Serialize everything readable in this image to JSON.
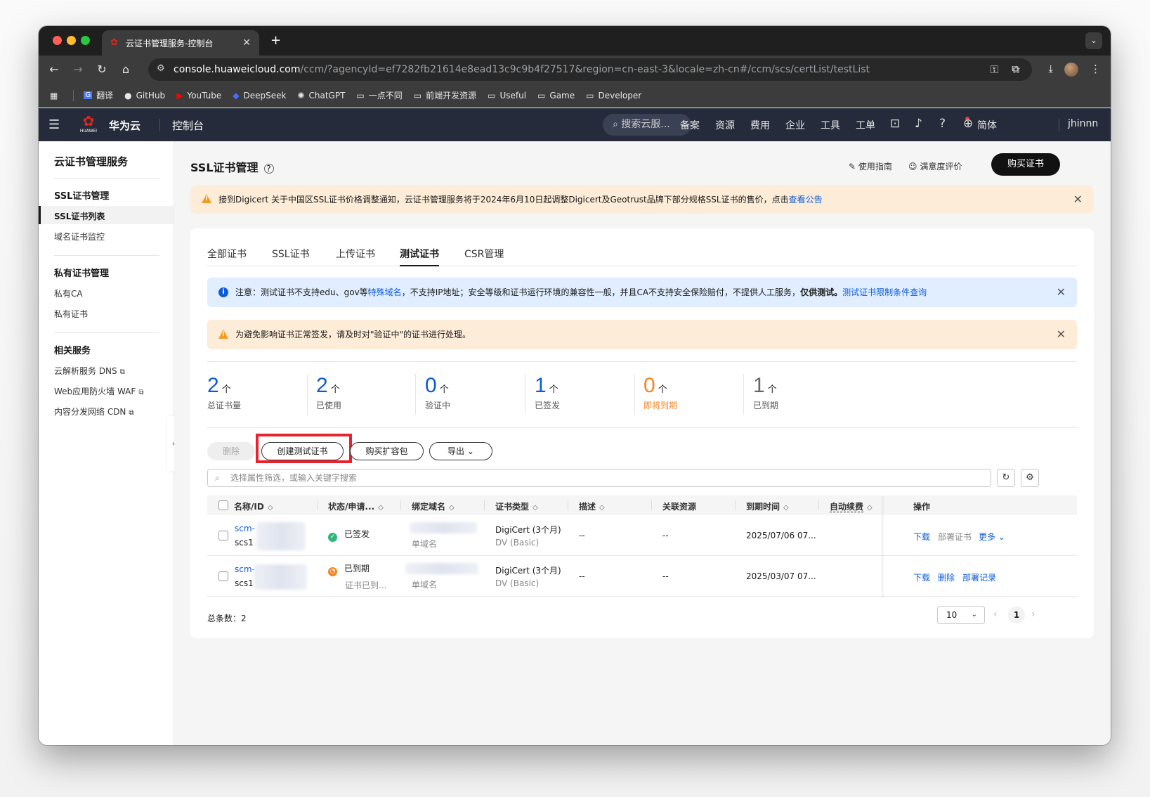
{
  "browser": {
    "tab_title": "云证书管理服务-控制台",
    "url_host": "console.huaweicloud.com",
    "url_path": "/ccm/?agencyId=ef7282fb21614e8ead13c9c9b4f27517&region=cn-east-3&locale=zh-cn#/ccm/scs/certList/testList",
    "bookmarks": [
      "翻译",
      "GitHub",
      "YouTube",
      "DeepSeek",
      "ChatGPT",
      "一点不同",
      "前端开发资源",
      "Useful",
      "Game",
      "Developer"
    ]
  },
  "header": {
    "brand": "华为云",
    "logo_text": "HUAWEI",
    "console": "控制台",
    "search_placeholder": "搜索云服...",
    "nav": [
      "备案",
      "资源",
      "费用",
      "企业",
      "工具",
      "工单"
    ],
    "language": "简体",
    "username": "jhinnn"
  },
  "sidebar": {
    "title": "云证书管理服务",
    "group1": "SSL证书管理",
    "item1": "SSL证书列表",
    "item2": "域名证书监控",
    "group2": "私有证书管理",
    "item3": "私有CA",
    "item4": "私有证书",
    "group3": "相关服务",
    "item5": "云解析服务 DNS",
    "item6": "Web应用防火墙 WAF",
    "item7": "内容分发网络 CDN"
  },
  "page": {
    "title": "SSL证书管理",
    "guide": "使用指南",
    "rating": "满意度评价",
    "buy": "购买证书",
    "notice_text": "接到Digicert 关于中国区SSL证书价格调整通知，云证书管理服务将于2024年6月10日起调整Digicert及Geotrust品牌下部分规格SSL证书的售价，点击",
    "notice_link": "查看公告"
  },
  "tabs": [
    "全部证书",
    "SSL证书",
    "上传证书",
    "测试证书",
    "CSR管理"
  ],
  "info": {
    "prefix": "注意：测试证书不支持edu、gov等",
    "link1": "特殊域名",
    "middle": "，不支持IP地址；安全等级和证书运行环境的兼容性一般，并且CA不支持安全保险赔付，不提供人工服务，",
    "bold": "仅供测试。",
    "link2": "测试证书限制条件查询"
  },
  "warn": "为避免影响证书正常签发，请及时对\"验证中\"的证书进行处理。",
  "stats": {
    "unit": "个",
    "items": [
      {
        "value": "2",
        "label": "总证书量"
      },
      {
        "value": "2",
        "label": "已使用"
      },
      {
        "value": "0",
        "label": "验证中"
      },
      {
        "value": "1",
        "label": "已签发"
      },
      {
        "value": "0",
        "label": "即将到期"
      },
      {
        "value": "1",
        "label": "已到期"
      }
    ]
  },
  "actions": {
    "delete": "删除",
    "create": "创建测试证书",
    "buy_pack": "购买扩容包",
    "export": "导出"
  },
  "filter_placeholder": "选择属性筛选，或输入关键字搜索",
  "table": {
    "columns": [
      "名称/ID",
      "状态/申请...",
      "绑定域名",
      "证书类型",
      "描述",
      "关联资源",
      "到期时间",
      "自动续费",
      "操作"
    ],
    "rows": [
      {
        "name": "scm-",
        "id": "scs1",
        "status": "已签发",
        "status_sub": "",
        "domain_type": "单域名",
        "cert_type": "DigiCert (3个月)",
        "cert_sub": "DV (Basic)",
        "desc": "--",
        "resource": "--",
        "expire": "2025/07/06 07...",
        "ops": [
          "下载",
          "部署证书",
          "更多"
        ]
      },
      {
        "name": "scm-",
        "id": "scs1",
        "status": "已到期",
        "status_sub": "证书已到...",
        "domain_type": "单域名",
        "cert_type": "DigiCert (3个月)",
        "cert_sub": "DV (Basic)",
        "desc": "--",
        "resource": "--",
        "expire": "2025/03/07 07...",
        "ops": [
          "下载",
          "删除",
          "部署记录"
        ]
      }
    ]
  },
  "pagination": {
    "total_label": "总条数：2",
    "page_size": "10",
    "current": "1"
  },
  "colors": {
    "accent": "#0d5bd8",
    "warning": "#f5851f",
    "success": "#2fb67c",
    "highlight": "#e8222e",
    "header_bg": "#252b3a"
  }
}
